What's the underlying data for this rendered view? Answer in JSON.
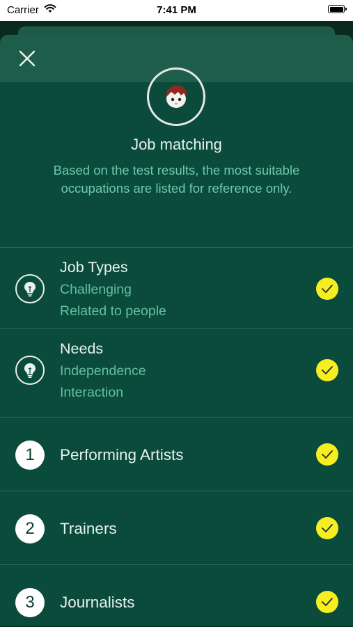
{
  "status_bar": {
    "carrier": "Carrier",
    "time": "7:41 PM"
  },
  "header": {
    "close_icon": "close-icon"
  },
  "main": {
    "avatar_icon": "boy-avatar-icon",
    "title": "Job matching",
    "subtitle": "Based on the test results, the most suitable occupations are listed for reference only."
  },
  "criteria": [
    {
      "icon": "lightbulb-icon",
      "heading": "Job Types",
      "lines": [
        "Challenging",
        "Related to people"
      ],
      "checked": true
    },
    {
      "icon": "lightbulb-icon",
      "heading": "Needs",
      "lines": [
        "Independence",
        "Interaction"
      ],
      "checked": true
    }
  ],
  "occupations": [
    {
      "number": "1",
      "label": "Performing Artists",
      "checked": true
    },
    {
      "number": "2",
      "label": "Trainers",
      "checked": true
    },
    {
      "number": "3",
      "label": "Journalists",
      "checked": true
    }
  ],
  "colors": {
    "background": "#0a4b3c",
    "header": "#1f5d4b",
    "accent_text": "#63c09f",
    "check": "#f7ee21"
  }
}
